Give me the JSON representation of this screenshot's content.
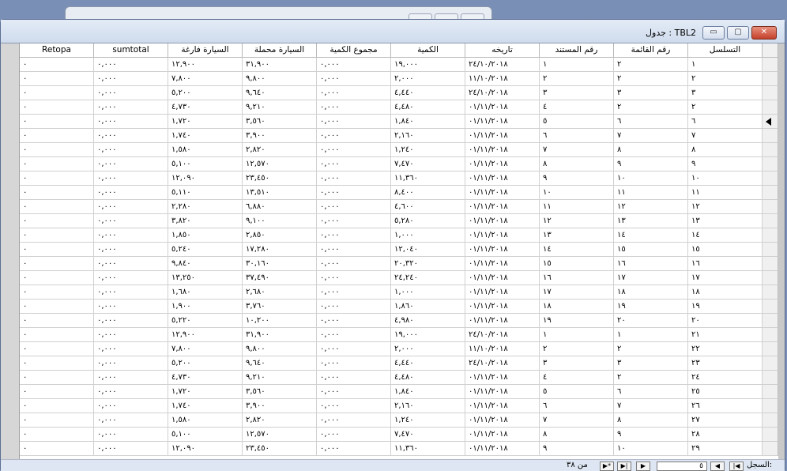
{
  "window": {
    "title": "TBL2 : جدول",
    "min_label": "▭",
    "max_label": "▢",
    "close_label": "✕"
  },
  "columns": [
    "Retopa",
    "sumtotal",
    "السيارة فارغة",
    "السيارة محملة",
    "مجموع الكمية",
    "الكمية",
    "تاريخه",
    "رقم المستند",
    "رقم القائمة",
    "التسلسل"
  ],
  "rows": [
    [
      "٠",
      "٠,٠٠٠",
      "١٢,٩٠٠",
      "٣١,٩٠٠",
      "٠,٠٠٠",
      "١٩,٠٠٠",
      "٢٤/١٠/٢٠١٨",
      "١",
      "٢",
      "١"
    ],
    [
      "٠",
      "٠,٠٠٠",
      "٧,٨٠٠",
      "٩,٨٠٠",
      "٠,٠٠٠",
      "٢,٠٠٠",
      "١١/١٠/٢٠١٨",
      "٢",
      "٢",
      "٢"
    ],
    [
      "٠",
      "٠,٠٠٠",
      "٥,٢٠٠",
      "٩,٦٤٠",
      "٠,٠٠٠",
      "٤,٤٤٠",
      "٢٤/١٠/٢٠١٨",
      "٣",
      "٣",
      "٣"
    ],
    [
      "٠",
      "٠,٠٠٠",
      "٤,٧٣٠",
      "٩,٢١٠",
      "٠,٠٠٠",
      "٤,٤٨٠",
      "٠١/١١/٢٠١٨",
      "٤",
      "٢",
      "٢"
    ],
    [
      "٠",
      "٠,٠٠٠",
      "١,٧٢٠",
      "٣,٥٦٠",
      "٠,٠٠٠",
      "١,٨٤٠",
      "٠١/١١/٢٠١٨",
      "٥",
      "٦",
      "٦"
    ],
    [
      "٠",
      "٠,٠٠٠",
      "١,٧٤٠",
      "٣,٩٠٠",
      "٠,٠٠٠",
      "٢,١٦٠",
      "٠١/١١/٢٠١٨",
      "٦",
      "٧",
      "٧"
    ],
    [
      "٠",
      "٠,٠٠٠",
      "١,٥٨٠",
      "٢,٨٢٠",
      "٠,٠٠٠",
      "١,٢٤٠",
      "٠١/١١/٢٠١٨",
      "٧",
      "٨",
      "٨"
    ],
    [
      "٠",
      "٠,٠٠٠",
      "٥,١٠٠",
      "١٢,٥٧٠",
      "٠,٠٠٠",
      "٧,٤٧٠",
      "٠١/١١/٢٠١٨",
      "٨",
      "٩",
      "٩"
    ],
    [
      "٠",
      "٠,٠٠٠",
      "١٢,٠٩٠",
      "٢٣,٤٥٠",
      "٠,٠٠٠",
      "١١,٣٦٠",
      "٠١/١١/٢٠١٨",
      "٩",
      "١٠",
      "١٠"
    ],
    [
      "٠",
      "٠,٠٠٠",
      "٥,١١٠",
      "١٣,٥١٠",
      "٠,٠٠٠",
      "٨,٤٠٠",
      "٠١/١١/٢٠١٨",
      "١٠",
      "١١",
      "١١"
    ],
    [
      "٠",
      "٠,٠٠٠",
      "٢,٢٨٠",
      "٦,٨٨٠",
      "٠,٠٠٠",
      "٤,٦٠٠",
      "٠١/١١/٢٠١٨",
      "١١",
      "١٢",
      "١٢"
    ],
    [
      "٠",
      "٠,٠٠٠",
      "٣,٨٢٠",
      "٩,١٠٠",
      "٠,٠٠٠",
      "٥,٢٨٠",
      "٠١/١١/٢٠١٨",
      "١٢",
      "١٣",
      "١٣"
    ],
    [
      "٠",
      "٠,٠٠٠",
      "١,٨٥٠",
      "٢,٨٥٠",
      "٠,٠٠٠",
      "١,٠٠٠",
      "٠١/١١/٢٠١٨",
      "١٣",
      "١٤",
      "١٤"
    ],
    [
      "٠",
      "٠,٠٠٠",
      "٥,٢٤٠",
      "١٧,٢٨٠",
      "٠,٠٠٠",
      "١٢,٠٤٠",
      "٠١/١١/٢٠١٨",
      "١٤",
      "١٥",
      "١٥"
    ],
    [
      "٠",
      "٠,٠٠٠",
      "٩,٨٤٠",
      "٣٠,١٦٠",
      "٠,٠٠٠",
      "٢٠,٣٢٠",
      "٠١/١١/٢٠١٨",
      "١٥",
      "١٦",
      "١٦"
    ],
    [
      "٠",
      "٠,٠٠٠",
      "١٣,٢٥٠",
      "٣٧,٤٩٠",
      "٠,٠٠٠",
      "٢٤,٢٤٠",
      "٠١/١١/٢٠١٨",
      "١٦",
      "١٧",
      "١٧"
    ],
    [
      "٠",
      "٠,٠٠٠",
      "١,٦٨٠",
      "٢,٦٨٠",
      "٠,٠٠٠",
      "١,٠٠٠",
      "٠١/١١/٢٠١٨",
      "١٧",
      "١٨",
      "١٨"
    ],
    [
      "٠",
      "٠,٠٠٠",
      "١,٩٠٠",
      "٣,٧٦٠",
      "٠,٠٠٠",
      "١,٨٦٠",
      "٠١/١١/٢٠١٨",
      "١٨",
      "١٩",
      "١٩"
    ],
    [
      "٠",
      "٠,٠٠٠",
      "٥,٢٢٠",
      "١٠,٢٠٠",
      "٠,٠٠٠",
      "٤,٩٨٠",
      "٠١/١١/٢٠١٨",
      "١٩",
      "٢٠",
      "٢٠"
    ],
    [
      "٠",
      "٠,٠٠٠",
      "١٢,٩٠٠",
      "٣١,٩٠٠",
      "٠,٠٠٠",
      "١٩,٠٠٠",
      "٢٤/١٠/٢٠١٨",
      "١",
      "١",
      "٢١"
    ],
    [
      "٠",
      "٠,٠٠٠",
      "٧,٨٠٠",
      "٩,٨٠٠",
      "٠,٠٠٠",
      "٢,٠٠٠",
      "١١/١٠/٢٠١٨",
      "٢",
      "٢",
      "٢٢"
    ],
    [
      "٠",
      "٠,٠٠٠",
      "٥,٢٠٠",
      "٩,٦٤٠",
      "٠,٠٠٠",
      "٤,٤٤٠",
      "٢٤/١٠/٢٠١٨",
      "٣",
      "٣",
      "٢٣"
    ],
    [
      "٠",
      "٠,٠٠٠",
      "٤,٧٣٠",
      "٩,٢١٠",
      "٠,٠٠٠",
      "٤,٤٨٠",
      "٠١/١١/٢٠١٨",
      "٤",
      "٢",
      "٢٤"
    ],
    [
      "٠",
      "٠,٠٠٠",
      "١,٧٢٠",
      "٣,٥٦٠",
      "٠,٠٠٠",
      "١,٨٤٠",
      "٠١/١١/٢٠١٨",
      "٥",
      "٦",
      "٢٥"
    ],
    [
      "٠",
      "٠,٠٠٠",
      "١,٧٤٠",
      "٣,٩٠٠",
      "٠,٠٠٠",
      "٢,١٦٠",
      "٠١/١١/٢٠١٨",
      "٦",
      "٧",
      "٢٦"
    ],
    [
      "٠",
      "٠,٠٠٠",
      "١,٥٨٠",
      "٢,٨٢٠",
      "٠,٠٠٠",
      "١,٢٤٠",
      "٠١/١١/٢٠١٨",
      "٧",
      "٨",
      "٢٧"
    ],
    [
      "٠",
      "٠,٠٠٠",
      "٥,١٠٠",
      "١٢,٥٧٠",
      "٠,٠٠٠",
      "٧,٤٧٠",
      "٠١/١١/٢٠١٨",
      "٨",
      "٩",
      "٢٨"
    ],
    [
      "٠",
      "٠,٠٠٠",
      "١٢,٠٩٠",
      "٢٣,٤٥٠",
      "٠,٠٠٠",
      "١١,٣٦٠",
      "٠١/١١/٢٠١٨",
      "٩",
      "١٠",
      "٢٩"
    ]
  ],
  "current_row_index": 4,
  "navigation": {
    "label": "السجل:",
    "record_count": "من ٣٨",
    "current_record": "٥"
  }
}
